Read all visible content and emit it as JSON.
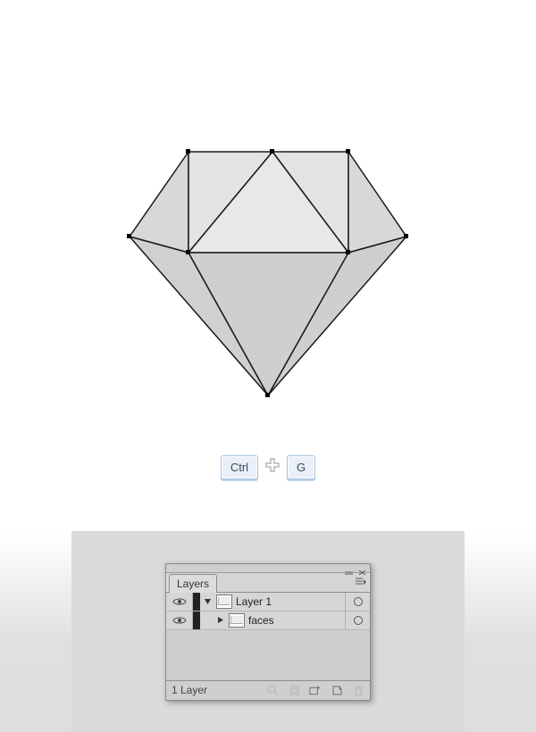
{
  "keys": {
    "ctrl": "Ctrl",
    "g": "G"
  },
  "panel": {
    "tab_label": "Layers",
    "layers": [
      {
        "name": "Layer 1"
      },
      {
        "name": "faces"
      }
    ],
    "footer_count": "1 Layer"
  }
}
